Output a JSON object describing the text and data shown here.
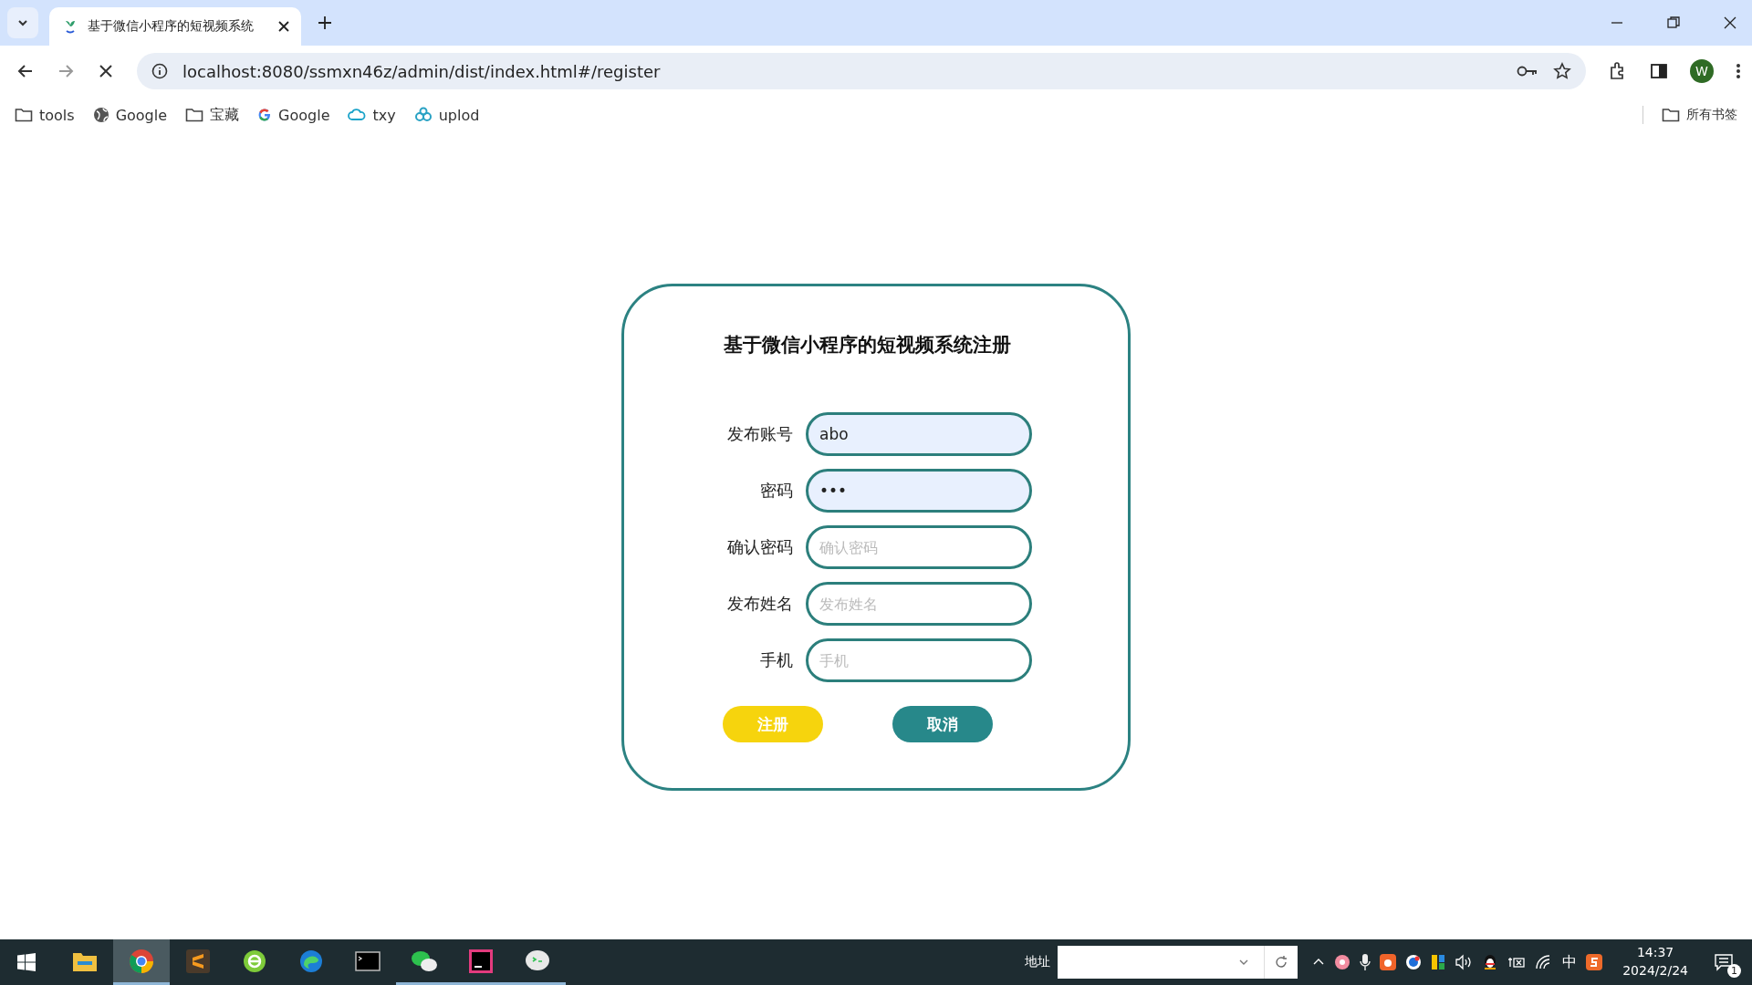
{
  "browser": {
    "tab": {
      "title": "基于微信小程序的短视频系统"
    },
    "url": "localhost:8080/ssmxn46z/admin/dist/index.html#/register",
    "profile_initial": "W",
    "bookmarks": [
      {
        "kind": "folder",
        "label": "tools"
      },
      {
        "kind": "globe",
        "label": "Google"
      },
      {
        "kind": "folder",
        "label": "宝藏"
      },
      {
        "kind": "google",
        "label": "Google"
      },
      {
        "kind": "cloud",
        "label": "txy"
      },
      {
        "kind": "link",
        "label": "uplod"
      }
    ],
    "all_bookmarks": "所有书签"
  },
  "form": {
    "title": "基于微信小程序的短视频系统注册",
    "fields": [
      {
        "label": "发布账号",
        "value": "abo",
        "autofilled": true
      },
      {
        "label": "密码",
        "value": "•••",
        "autofilled": true
      },
      {
        "label": "确认密码",
        "placeholder": "确认密码",
        "autofilled": false
      },
      {
        "label": "发布姓名",
        "placeholder": "发布姓名",
        "autofilled": false
      },
      {
        "label": "手机",
        "placeholder": "手机",
        "autofilled": false
      }
    ],
    "buttons": [
      {
        "kind": "primary",
        "label": "注册"
      },
      {
        "kind": "secondary",
        "label": "取消"
      }
    ]
  },
  "taskbar": {
    "apps": [
      {
        "kind": "explorer",
        "selected": false,
        "running": false
      },
      {
        "kind": "chrome",
        "selected": true,
        "running": true
      },
      {
        "kind": "sublime",
        "selected": false,
        "running": false
      },
      {
        "kind": "ie",
        "selected": false,
        "running": false
      },
      {
        "kind": "edge",
        "selected": false,
        "running": false
      },
      {
        "kind": "terminal",
        "selected": false,
        "running": false
      },
      {
        "kind": "wechat",
        "selected": false,
        "running": true
      },
      {
        "kind": "intellij",
        "selected": false,
        "running": true
      },
      {
        "kind": "chat",
        "selected": false,
        "running": true
      }
    ],
    "address_label": "地址",
    "ime": "中",
    "time": "14:37",
    "date": "2024/2/24",
    "notifications": "1"
  }
}
